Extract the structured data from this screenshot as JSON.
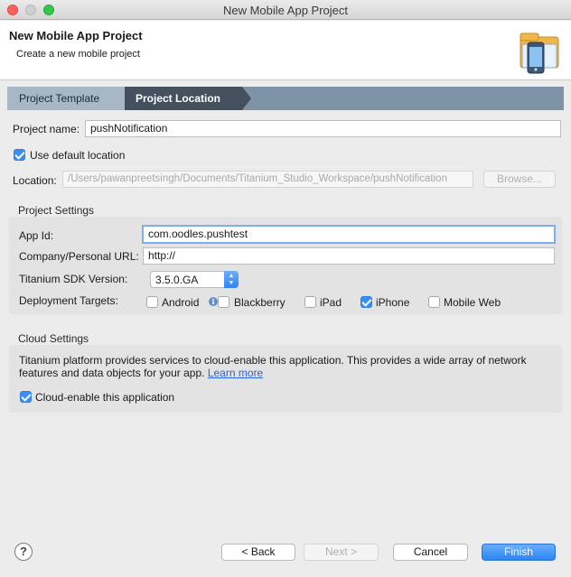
{
  "window": {
    "title": "New Mobile App Project"
  },
  "header": {
    "title": "New Mobile App Project",
    "description": "Create a new mobile project",
    "icon": "mobile-project-icon"
  },
  "steps": [
    {
      "label": "Project Template",
      "active": false
    },
    {
      "label": "Project Location",
      "active": true
    }
  ],
  "project": {
    "name_label": "Project name:",
    "name_value": "pushNotification",
    "use_default_label": "Use default location",
    "use_default_checked": true,
    "location_label": "Location:",
    "location_value": "/Users/pawanpreetsingh/Documents/Titanium_Studio_Workspace/pushNotification",
    "browse_label": "Browse..."
  },
  "settings": {
    "title": "Project Settings",
    "app_id_label": "App Id:",
    "app_id_value": "com.oodles.pushtest",
    "url_label": "Company/Personal URL:",
    "url_value": "http://",
    "sdk_label": "Titanium SDK Version:",
    "sdk_value": "3.5.0.GA",
    "targets_label": "Deployment Targets:",
    "targets": [
      {
        "label": "Android",
        "checked": false
      },
      {
        "label": "Blackberry",
        "checked": false
      },
      {
        "label": "iPad",
        "checked": false
      },
      {
        "label": "iPhone",
        "checked": true
      },
      {
        "label": "Mobile Web",
        "checked": false
      }
    ]
  },
  "cloud": {
    "title": "Cloud Settings",
    "description": "Titanium platform provides services to cloud-enable this application. This provides a wide array of network features and data objects for your app.",
    "learn_more": "Learn more",
    "enable_label": "Cloud-enable this application",
    "enable_checked": true
  },
  "footer": {
    "back_label": "< Back",
    "next_label": "Next >",
    "cancel_label": "Cancel",
    "finish_label": "Finish"
  },
  "colors": {
    "accent": "#2d84f3",
    "step_active": "#44505d",
    "step_inactive": "#a7b7c6"
  }
}
